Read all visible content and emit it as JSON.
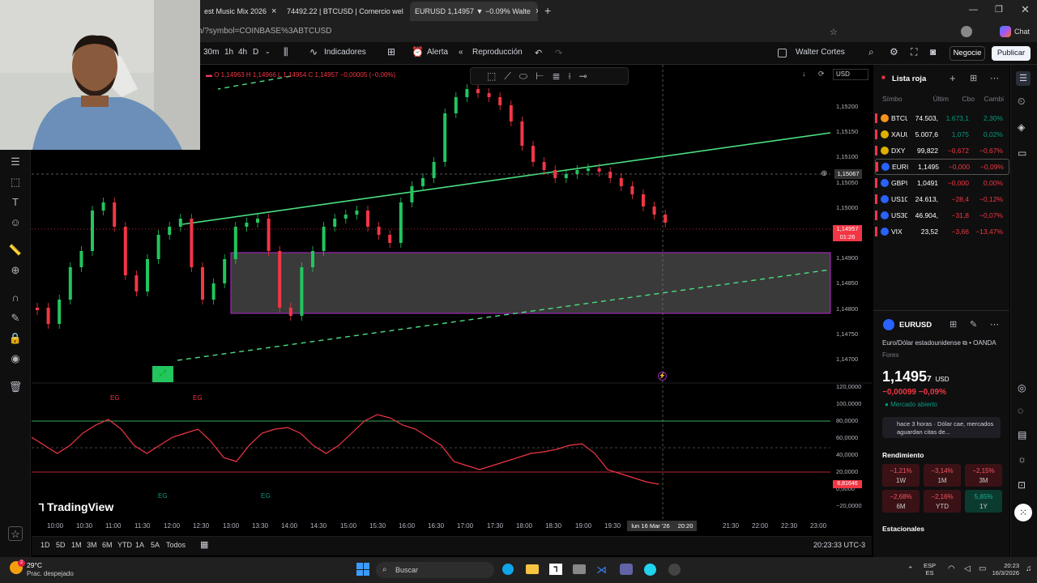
{
  "browser": {
    "tabs": [
      {
        "label": "est Music Mix 2026"
      },
      {
        "label": "74492.22 | BTCUSD | Comercio wel"
      },
      {
        "label": "EURUSD 1,14957 ▼ −0.09% Walte"
      }
    ],
    "url": "h/?symbol=COINBASE%3ABTCUSD",
    "chat": "Chat"
  },
  "toolbar": {
    "intervals": [
      "30m",
      "1h",
      "4h",
      "D"
    ],
    "indicators": "Indicadores",
    "alert": "Alerta",
    "replay": "Reproducción",
    "user": "Walter Cortes",
    "trade": "Negocie",
    "publish": "Publicar"
  },
  "chart": {
    "ohlc": {
      "o": "O 1,14963",
      "h": "H 1,14966",
      "l": "L 1,14954",
      "c": "C 1,14957",
      "chg": "−0,00005 (−0,00%)"
    },
    "currency": "USD",
    "price_axis": [
      "1,15200",
      "1,15150",
      "1,15100",
      "1,15050",
      "1,15000",
      "1,14950",
      "1,14900",
      "1,14850",
      "1,14800",
      "1,14750",
      "1,14700"
    ],
    "crosshair_price": "1,15067",
    "last_price": "1,14957",
    "countdown": "01:26",
    "osc_axis": [
      "120,0000",
      "100,0000",
      "80,0000",
      "60,0000",
      "40,0000",
      "20,0000",
      "0,0000",
      "−20,0000"
    ],
    "osc_last": "6,81646",
    "time_axis": [
      "10:00",
      "10:30",
      "11:00",
      "11:30",
      "12:00",
      "12:30",
      "13:00",
      "13:30",
      "14:00",
      "14:30",
      "15:00",
      "15:30",
      "16:00",
      "16:30",
      "17:00",
      "17:30",
      "18:00",
      "18:30",
      "19:00",
      "19:30",
      "20:00",
      "21:30",
      "22:00",
      "22:30",
      "23:00"
    ],
    "time_cross": "lun 16 Mar '26",
    "time_cross2": "20:20",
    "eg_top": [
      "EG",
      "EG"
    ],
    "eg_bottom": [
      "EG",
      "EG"
    ],
    "logo": "TradingView"
  },
  "bottom": {
    "ranges": [
      "1D",
      "5D",
      "1M",
      "3M",
      "6M",
      "YTD",
      "1A",
      "5A",
      "Todos"
    ],
    "clock": "20:23:33 UTC-3"
  },
  "watchlist": {
    "title": "Lista roja",
    "headers": [
      "Símbo",
      "Últim",
      "Cbo",
      "Cambi"
    ],
    "rows": [
      {
        "sym": "BTCU",
        "last": "74.503,",
        "chg": "1.673,1",
        "pct": "2,30%",
        "dir": "pos",
        "color": "#f7931a"
      },
      {
        "sym": "XAUU",
        "last": "5.007,6",
        "chg": "1,075",
        "pct": "0,02%",
        "dir": "pos",
        "color": "#e0b000"
      },
      {
        "sym": "DXY",
        "last": "99,822",
        "chg": "−0,672",
        "pct": "−0,67%",
        "dir": "neg",
        "color": "#e0b000"
      },
      {
        "sym": "EURU",
        "last": "1,1495",
        "chg": "−0,000",
        "pct": "−0,09%",
        "dir": "neg",
        "color": "#2962ff"
      },
      {
        "sym": "GBPU",
        "last": "1,0491",
        "chg": "−0,000",
        "pct": "0,00%",
        "dir": "neg",
        "color": "#2962ff"
      },
      {
        "sym": "US10",
        "last": "24.613,",
        "chg": "−28,4",
        "pct": "−0,12%",
        "dir": "neg",
        "color": "#2962ff"
      },
      {
        "sym": "US30",
        "last": "46.904,",
        "chg": "−31,8",
        "pct": "−0,07%",
        "dir": "neg",
        "color": "#2962ff"
      },
      {
        "sym": "VIX",
        "last": "23,52",
        "chg": "−3,66",
        "pct": "−13,47%",
        "dir": "neg",
        "color": "#2962ff"
      }
    ]
  },
  "detail": {
    "symbol": "EURUSD",
    "name": "Euro/Dólar estadounidense",
    "broker": "OANDA",
    "type": "Forex",
    "price": "1,1495",
    "price_small": "7",
    "currency": "USD",
    "change": "−0,00099",
    "change_pct": "−0,09%",
    "market": "Mercado abierto",
    "news_time": "hace 3 horas",
    "news_text": "Dólar cae, mercados aguardan citas de...",
    "perf_title": "Rendimiento",
    "perf": [
      {
        "v": "−1,21%",
        "l": "1W"
      },
      {
        "v": "−3,14%",
        "l": "1M"
      },
      {
        "v": "−2,15%",
        "l": "3M"
      },
      {
        "v": "−2,68%",
        "l": "6M"
      },
      {
        "v": "−2,16%",
        "l": "YTD"
      },
      {
        "v": "5,65%",
        "l": "1Y"
      }
    ],
    "seasonal": "Estacionales"
  },
  "taskbar": {
    "temp": "29°C",
    "weather": "Prac. despejado",
    "search": "Buscar",
    "lang1": "ESP",
    "lang2": "ES",
    "time": "20:23",
    "date": "16/3/2026",
    "badge": "2"
  }
}
